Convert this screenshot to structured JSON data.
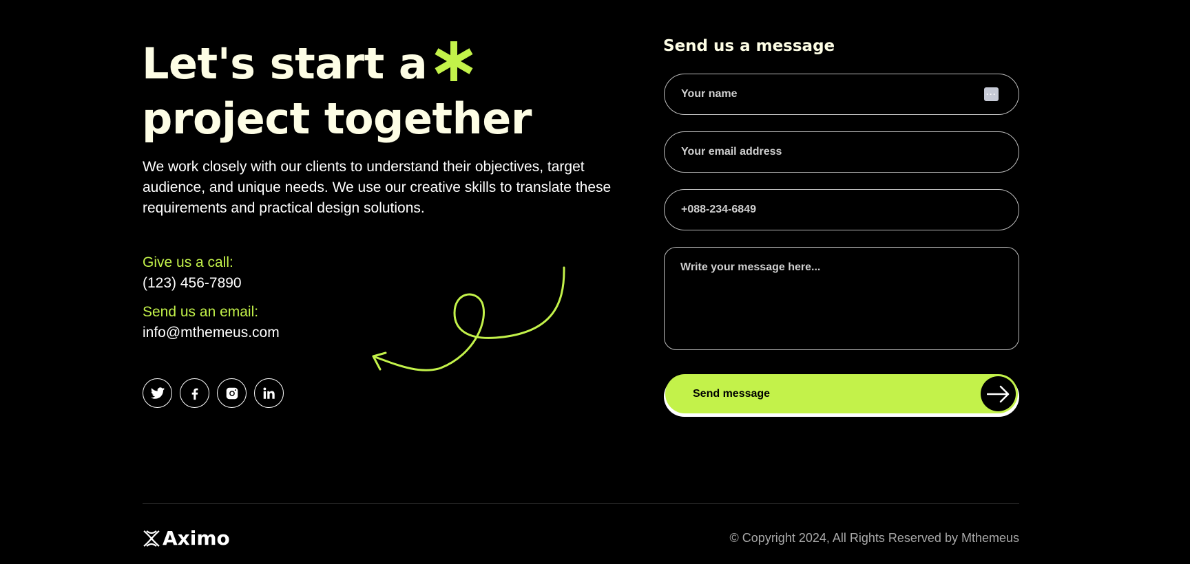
{
  "hero": {
    "headline_line1": "Let's start a",
    "headline_line2": "project together",
    "asterisk": "*",
    "intro": "We work closely with our clients to understand their objectives, target audience, and unique needs. We use our creative skills to translate these requirements and practical design solutions."
  },
  "contact": {
    "call_label": "Give us a call:",
    "phone": "(123) 456-7890",
    "email_label": "Send us an email:",
    "email": "info@mthemeus.com"
  },
  "socials": [
    {
      "name": "twitter-icon"
    },
    {
      "name": "facebook-icon"
    },
    {
      "name": "instagram-icon"
    },
    {
      "name": "linkedin-icon"
    }
  ],
  "form": {
    "title": "Send us a message",
    "name_placeholder": "Your name",
    "email_placeholder": "Your email address",
    "phone_placeholder": "+088-234-6849",
    "message_placeholder": "Write your message here...",
    "submit_label": "Send message"
  },
  "footer": {
    "logo_text": "Aximo",
    "copyright": "© Copyright 2024, All Rights Reserved by Mthemeus"
  },
  "colors": {
    "accent": "#c3f24a",
    "background": "#000000",
    "headline": "#fdfde5"
  }
}
